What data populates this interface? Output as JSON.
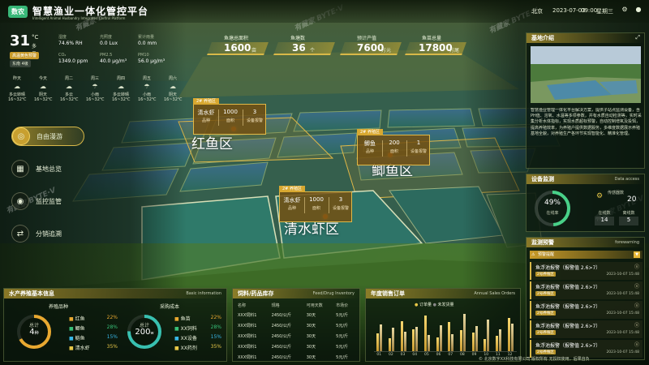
{
  "header": {
    "logo": "数农",
    "title": "智慧渔业一体化管控平台",
    "subtitle": "Intelligent Animal Husbandry Integrated Control Platform",
    "city": "北京",
    "date": "2023-07-03",
    "time": "09:00",
    "weekday": "星期三"
  },
  "weather": {
    "temp": "31",
    "unit": "°C",
    "condition": "多云",
    "badge_quality": "高温黄色预警",
    "badge_wind": "东南 4级",
    "measures": [
      {
        "label": "湿度",
        "value": "74.6% RH"
      },
      {
        "label": "光照度",
        "value": "0.0 Lux"
      },
      {
        "label": "累计雨量",
        "value": "0.0 mm"
      },
      {
        "label": "CO₂",
        "value": "1349.0 ppm"
      },
      {
        "label": "PM2.5",
        "value": "40.0 μg/m³"
      },
      {
        "label": "PM10",
        "value": "56.0 μg/m³"
      }
    ],
    "forecast": [
      {
        "day": "昨天",
        "cond": "多云转晴",
        "temp": "16~32℃"
      },
      {
        "day": "今天",
        "cond": "阴天",
        "temp": "16~32℃"
      },
      {
        "day": "周二",
        "cond": "多云",
        "temp": "16~32℃"
      },
      {
        "day": "周三",
        "cond": "小雨",
        "temp": "16~32℃"
      },
      {
        "day": "周四",
        "cond": "多云转晴",
        "temp": "16~32℃"
      },
      {
        "day": "周五",
        "cond": "小雨",
        "temp": "16~32℃"
      },
      {
        "day": "周六",
        "cond": "阴天",
        "temp": "16~32℃"
      }
    ]
  },
  "nav": [
    {
      "label": "自由漫游",
      "icon": "◎",
      "active": true
    },
    {
      "label": "基地总览",
      "icon": "▦",
      "active": false
    },
    {
      "label": "监控监管",
      "icon": "◉",
      "active": false
    },
    {
      "label": "分销追溯",
      "icon": "⇄",
      "active": false
    }
  ],
  "kpis": [
    {
      "label": "鱼塘总面积",
      "value": "1600",
      "unit": "亩"
    },
    {
      "label": "鱼塘数",
      "value": "36",
      "unit": "个"
    },
    {
      "label": "预计产值",
      "value": "7600",
      "unit": "万元"
    },
    {
      "label": "鱼苗总量",
      "value": "17800",
      "unit": "万尾"
    }
  ],
  "zones": [
    {
      "name": "红鱼区",
      "tag": "2# 养殖区",
      "species": "清水虾",
      "species_label": "品种",
      "area": "1000",
      "area_label": "面积",
      "devices": "3",
      "devices_label": "设备报警"
    },
    {
      "name": "鲫鱼区",
      "tag": "2# 养殖区",
      "species": "鲫鱼",
      "species_label": "品种",
      "area": "200",
      "area_label": "面积",
      "devices": "1",
      "devices_label": "设备报警"
    },
    {
      "name": "清水虾区",
      "tag": "2# 养殖区",
      "species": "清水虾",
      "species_label": "品种",
      "area": "1000",
      "area_label": "面积",
      "devices": "3",
      "devices_label": "设备报警"
    }
  ],
  "base_intro": {
    "title": "基地介绍",
    "text": "智慧渔业管理一体化平台解决方案，提供子站点监测设备，含PH值、溶氧、水温等多项参数，并有水质自动检测等，实时采集分析水体指标，实现水质超标预警，自动控制增氧及投饵，提高养殖效率，为养殖户提供数据服务，多维度数据展示养殖基地全貌，对养殖生产各环节实现智能化、精准化管理。"
  },
  "devices": {
    "title": "设备监测",
    "en": "Data access",
    "percent": "49%",
    "percent_label": "在线率",
    "total_label": "传感器数",
    "total": "20",
    "online_label": "在线数",
    "online": "14",
    "offline_label": "离线数",
    "offline": "5"
  },
  "alerts": {
    "title": "监测预警",
    "en": "forewarning",
    "tab": "预警提醒",
    "items": [
      {
        "title": "鱼浮池报警（报警值 2.6>7）",
        "tag": "2号养殖区",
        "date": "2023-10-07 15:48"
      },
      {
        "title": "鱼浮池报警（报警值 2.6>7）",
        "tag": "2号养殖区",
        "date": "2023-10-07 15:48"
      },
      {
        "title": "鱼浮池报警（报警值 2.6>7）",
        "tag": "2号养殖区",
        "date": "2023-10-07 15:48"
      },
      {
        "title": "鱼浮池报警（报警值 2.6>7）",
        "tag": "2号养殖区",
        "date": "2023-10-07 15:48"
      },
      {
        "title": "鱼浮池报警（报警值 2.6>7）",
        "tag": "2号养殖区",
        "date": "2023-10-07 15:48"
      }
    ]
  },
  "aquaculture": {
    "title": "水产养殖基本信息",
    "en": "Basic information",
    "species_title": "养殖品种",
    "species_total": "4",
    "species_unit": "种",
    "species": [
      {
        "name": "红鱼",
        "pct": "22%",
        "color": "#e8a830"
      },
      {
        "name": "鲫鱼",
        "pct": "28%",
        "color": "#38c078"
      },
      {
        "name": "鲢鱼",
        "pct": "15%",
        "color": "#38b8e8"
      },
      {
        "name": "清水虾",
        "pct": "35%",
        "color": "#e8c848"
      }
    ],
    "cost_title": "采购成本",
    "cost_total": "200",
    "cost_unit": "w",
    "costs": [
      {
        "name": "鱼苗",
        "pct": "22%",
        "color": "#e8a830"
      },
      {
        "name": "XX饲料",
        "pct": "28%",
        "color": "#38c078"
      },
      {
        "name": "XX设备",
        "pct": "15%",
        "color": "#38b8e8"
      },
      {
        "name": "XX药剂",
        "pct": "35%",
        "color": "#e8c848"
      }
    ]
  },
  "feed": {
    "title": "饲料/药品库存",
    "en": "Feed/Drug Inventory",
    "headers": [
      "名称",
      "规格",
      "可用天数",
      "市场价"
    ],
    "rows": [
      [
        "XXX饲料1",
        "2450/公斤",
        "30天",
        "5元/斤"
      ],
      [
        "XXX饲料1",
        "2450/公斤",
        "30天",
        "5元/斤"
      ],
      [
        "XXX饲料1",
        "2450/公斤",
        "30天",
        "5元/斤"
      ],
      [
        "XXX饲料1",
        "2450/公斤",
        "30天",
        "5元/斤"
      ],
      [
        "XXX饲料1",
        "2450/公斤",
        "30天",
        "5元/斤"
      ]
    ]
  },
  "chart_data": {
    "type": "bar",
    "title": "年度销售订单",
    "subtitle": "Annual Sales Orders",
    "legend": [
      "订单量",
      "未发货量"
    ],
    "ylim": [
      0,
      100
    ],
    "categories": [
      "01",
      "02",
      "03",
      "04",
      "05",
      "06",
      "07",
      "08",
      "09",
      "10",
      "11",
      "12"
    ],
    "values": [
      [
        42,
        64
      ],
      [
        30,
        55
      ],
      [
        72,
        46
      ],
      [
        52,
        58
      ],
      [
        84,
        38
      ],
      [
        32,
        62
      ],
      [
        70,
        40
      ],
      [
        50,
        88
      ],
      [
        44,
        60
      ],
      [
        28,
        75
      ],
      [
        36,
        52
      ],
      [
        78,
        66
      ]
    ]
  },
  "footer": "© 北京数字XX科技有限公司  版权所有  无授权使用，后果自负"
}
